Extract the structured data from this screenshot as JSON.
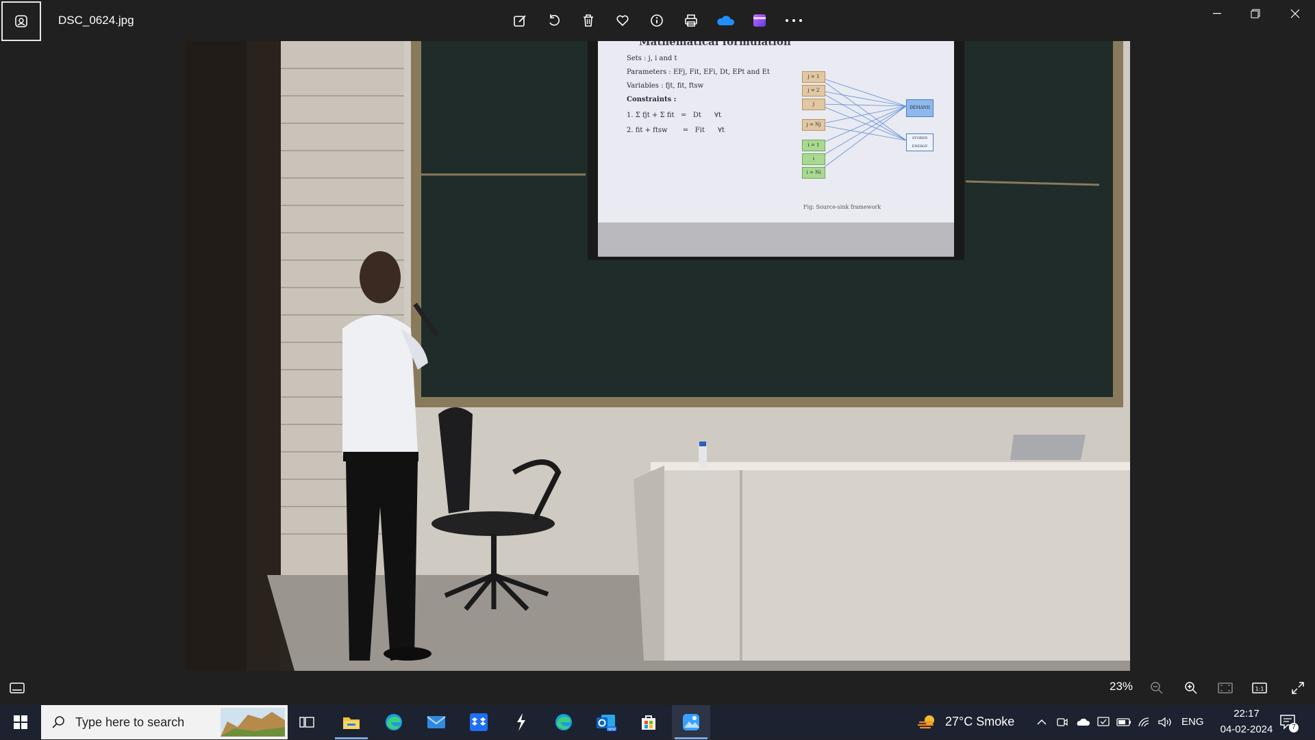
{
  "window": {
    "file_name": "DSC_0624.jpg"
  },
  "toolbar": {
    "icons": [
      "edit-image-icon",
      "rotate-icon",
      "delete-icon",
      "favorite-heart-icon",
      "info-icon",
      "print-icon",
      "onedrive-icon",
      "clipchamp-icon",
      "more-icon"
    ]
  },
  "slide": {
    "heading": "Mathematical formulation",
    "sets": "Sets : j, i and t",
    "parameters": "Parameters : EFj, Fit, EFi, Dt, EPt and Et",
    "variables": "Variables : fjt, fit, ftsw",
    "constraints": "Constraints :",
    "eq1": "1. Σ fjt + Σ fit   =   Dt      ∀t",
    "eq2": "2. fit + ftsw       =   Fit      ∀t",
    "demand": "DEMAND",
    "stored": "STORED ENERGY",
    "caption": "Fig: Source-sink framework",
    "nodes_existing": [
      "j = 1",
      "j = 2",
      "j",
      "j = Nj"
    ],
    "nodes_new": [
      "i = 1",
      "i",
      "i = Ni"
    ]
  },
  "viewer_bar": {
    "zoom": "23%"
  },
  "taskbar": {
    "search_placeholder": "Type here to search",
    "weather": "27°C  Smoke",
    "language": "ENG",
    "time": "22:17",
    "date": "04-02-2024",
    "notification_count": "7"
  },
  "colors": {
    "background": "#202020",
    "taskbar": "#1c2230",
    "accent": "#4a9be8"
  }
}
